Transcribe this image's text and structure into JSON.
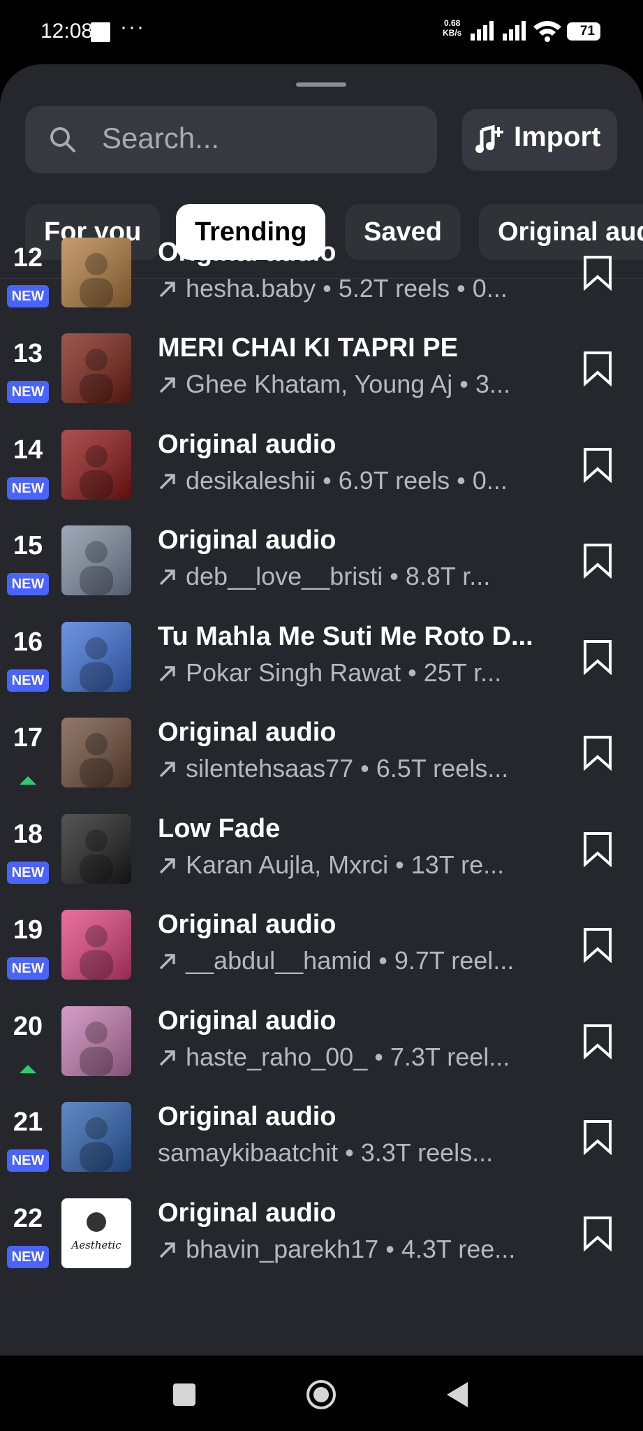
{
  "status_bar": {
    "time": "12:08",
    "dots": "···",
    "speed_value": "0.68",
    "speed_unit": "KB/s",
    "battery": "71"
  },
  "search": {
    "placeholder": "Search..."
  },
  "import_button": {
    "label": "Import"
  },
  "tabs": [
    {
      "label": "For you",
      "active": false
    },
    {
      "label": "Trending",
      "active": true
    },
    {
      "label": "Saved",
      "active": false
    },
    {
      "label": "Original audio",
      "active": false
    }
  ],
  "tracks": [
    {
      "rank": "12",
      "badge": "NEW",
      "title": "Original audio",
      "subtitle": "hesha.baby • 5.2T reels • 0...",
      "trend_arrow": true,
      "thumb_color": "#b07a3c"
    },
    {
      "rank": "13",
      "badge": "NEW",
      "title": "MERI CHAI KI TAPRI PE",
      "subtitle": "Ghee Khatam, Young Aj • 3...",
      "trend_arrow": true,
      "thumb_color": "#7a1e12"
    },
    {
      "rank": "14",
      "badge": "NEW",
      "title": "Original audio",
      "subtitle": "desikaleshii • 6.9T reels • 0...",
      "trend_arrow": true,
      "thumb_color": "#8e1414"
    },
    {
      "rank": "15",
      "badge": "NEW",
      "title": "Original audio",
      "subtitle": "deb__love__bristi • 8.8T r...",
      "trend_arrow": true,
      "thumb_color": "#7d8ba0"
    },
    {
      "rank": "16",
      "badge": "NEW",
      "title": "Tu Mahla Me Suti Me Roto D...",
      "subtitle": "Pokar Singh Rawat • 25T r...",
      "trend_arrow": true,
      "thumb_color": "#3b6fd8"
    },
    {
      "rank": "17",
      "badge": "UP",
      "title": "Original audio",
      "subtitle": "silentehsaas77 • 6.5T reels...",
      "trend_arrow": true,
      "thumb_color": "#6b4a36"
    },
    {
      "rank": "18",
      "badge": "NEW",
      "title": "Low Fade",
      "subtitle": "Karan Aujla, Mxrci • 13T re...",
      "trend_arrow": true,
      "thumb_color": "#1a1a1a"
    },
    {
      "rank": "19",
      "badge": "NEW",
      "title": "Original audio",
      "subtitle": "__abdul__hamid • 9.7T reel...",
      "trend_arrow": true,
      "thumb_color": "#e0407a"
    },
    {
      "rank": "20",
      "badge": "UP",
      "title": "Original audio",
      "subtitle": "haste_raho_00_ • 7.3T reel...",
      "trend_arrow": true,
      "thumb_color": "#c47ab0"
    },
    {
      "rank": "21",
      "badge": "NEW",
      "title": "Original audio",
      "subtitle": "samaykibaatchit • 3.3T reels...",
      "trend_arrow": false,
      "thumb_color": "#2a5fb0"
    },
    {
      "rank": "22",
      "badge": "NEW",
      "title": "Original audio",
      "subtitle": "bhavin_parekh17 • 4.3T ree...",
      "trend_arrow": true,
      "thumb_color": "#ffffff",
      "thumb_text": "Aesthetic"
    }
  ],
  "colors": {
    "sheet_bg": "#25272c",
    "new_badge": "#4a63ff",
    "up_arrow": "#2ecc71"
  }
}
